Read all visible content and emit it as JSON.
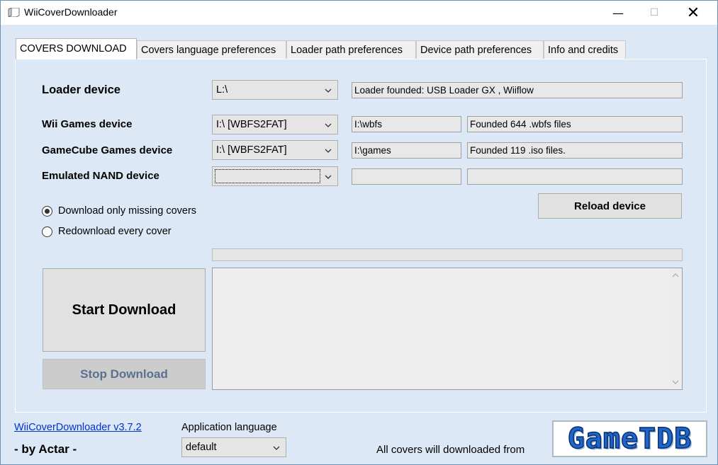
{
  "window": {
    "title": "WiiCoverDownloader",
    "minimize_glyph": "—",
    "maximize_glyph": "☐",
    "close_glyph": "✕"
  },
  "tabs": [
    {
      "label": "COVERS DOWNLOAD",
      "active": true
    },
    {
      "label": "Covers language preferences",
      "active": false
    },
    {
      "label": "Loader path preferences",
      "active": false
    },
    {
      "label": "Device path preferences",
      "active": false
    },
    {
      "label": "Info and credits",
      "active": false
    }
  ],
  "devices": {
    "loader": {
      "label": "Loader device",
      "selected": "L:\\",
      "status": "Loader founded: USB Loader GX , Wiiflow"
    },
    "wii": {
      "label": "Wii Games device",
      "selected": "I:\\ [WBFS2FAT]",
      "path": "I:\\wbfs",
      "status": "Founded 644 .wbfs files"
    },
    "gamecube": {
      "label": "GameCube Games device",
      "selected": "I:\\ [WBFS2FAT]",
      "path": "I:\\games",
      "status": "Founded 119 .iso files."
    },
    "nand": {
      "label": "Emulated NAND device",
      "selected": "",
      "path": "",
      "status": ""
    }
  },
  "reload_button": "Reload device",
  "download_mode": {
    "options": [
      {
        "label": "Download only missing covers",
        "checked": true
      },
      {
        "label": "Redownload every cover",
        "checked": false
      }
    ]
  },
  "progress": {
    "value": 0
  },
  "start_button": "Start Download",
  "stop_button": "Stop Download",
  "log_text": "",
  "footer": {
    "version_link": "WiiCoverDownloader v3.7.2",
    "author": "- by Actar -",
    "app_language_label": "Application language",
    "app_language_value": "default",
    "covers_source_text": "All covers will downloaded from",
    "logo_text": "GameTDB"
  },
  "colors": {
    "window_bg": "#dce8f5",
    "link": "#0033cc",
    "logo_blue": "#1e66c8"
  },
  "icons": {
    "app": "app-icon",
    "dropdown": "chevron-down-icon",
    "scroll_up": "scroll-up-arrow-icon",
    "scroll_down": "scroll-down-arrow-icon"
  }
}
